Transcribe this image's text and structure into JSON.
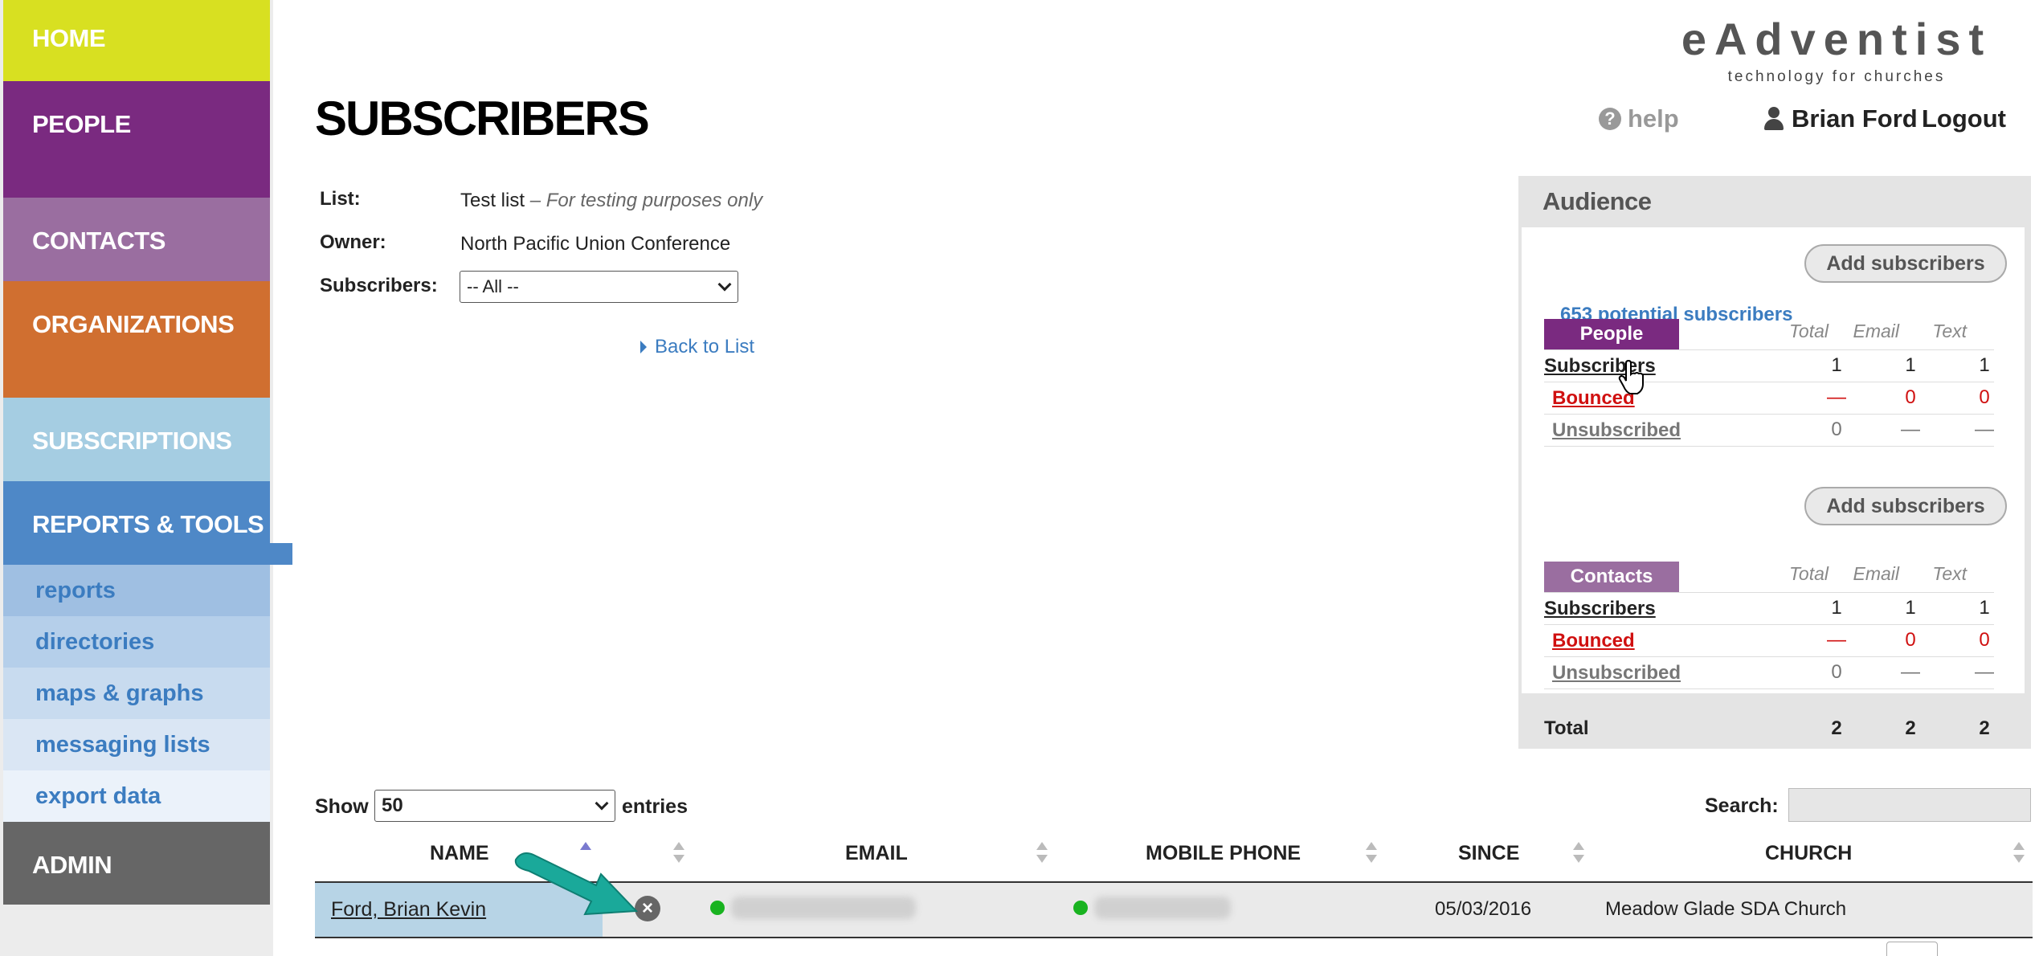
{
  "sidebar": {
    "home": "HOME",
    "people": "PEOPLE",
    "contacts": "CONTACTS",
    "organizations": "ORGANIZATIONS",
    "subscriptions": "SUBSCRIPTIONS",
    "reports_tools": "REPORTS & TOOLS",
    "sub_items": [
      "reports",
      "directories",
      "maps & graphs",
      "messaging lists",
      "export data"
    ],
    "admin": "ADMIN"
  },
  "header": {
    "page_title": "SUBSCRIBERS",
    "logo_main": "eAdventist",
    "logo_sub": "technology for churches",
    "help": "help",
    "user_name": "Brian Ford",
    "logout": "Logout"
  },
  "list_info": {
    "list_label": "List:",
    "list_name": "Test list",
    "list_desc": "– For testing purposes only",
    "owner_label": "Owner:",
    "owner_value": "North Pacific Union Conference",
    "subscribers_label": "Subscribers:",
    "subscribers_filter": "-- All --",
    "back_link": "Back to List"
  },
  "audience": {
    "title": "Audience",
    "potential": "653 potential subscribers",
    "add_button": "Add subscribers",
    "col_total": "Total",
    "col_email": "Email",
    "col_text": "Text",
    "groups": [
      {
        "name": "People",
        "rows": [
          {
            "label": "Subscribers",
            "total": "1",
            "email": "1",
            "text": "1"
          },
          {
            "label": "Bounced",
            "total": "—",
            "email": "0",
            "text": "0"
          },
          {
            "label": "Unsubscribed",
            "total": "0",
            "email": "—",
            "text": "—"
          }
        ]
      },
      {
        "name": "Contacts",
        "rows": [
          {
            "label": "Subscribers",
            "total": "1",
            "email": "1",
            "text": "1"
          },
          {
            "label": "Bounced",
            "total": "—",
            "email": "0",
            "text": "0"
          },
          {
            "label": "Unsubscribed",
            "total": "0",
            "email": "—",
            "text": "—"
          }
        ]
      }
    ],
    "total_label": "Total",
    "total_total": "2",
    "total_email": "2",
    "total_text": "2"
  },
  "table": {
    "show_label": "Show",
    "page_size": "50",
    "entries_label": "entries",
    "search_label": "Search:",
    "columns": [
      "NAME",
      "EMAIL",
      "MOBILE PHONE",
      "SINCE",
      "CHURCH"
    ],
    "rows": [
      {
        "name": "Ford, Brian Kevin",
        "since": "05/03/2016",
        "church": "Meadow Glade SDA Church"
      }
    ]
  },
  "colors": {
    "home": "#d8e021",
    "people": "#7a2a80",
    "contacts": "#9a6ea0",
    "organizations": "#d06f30",
    "subscriptions": "#a5cde2",
    "reports": "#4e88c7",
    "admin": "#666666",
    "link": "#3b7cc0",
    "bounced": "#d01010",
    "status_dot": "#19b320",
    "arrow": "#1aa99a"
  }
}
